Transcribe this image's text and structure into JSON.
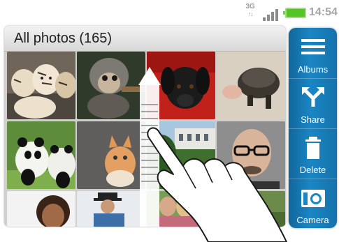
{
  "status_bar": {
    "network": "3G",
    "data_arrows": "↑↓",
    "time": "14:54",
    "battery_color": "#55c525"
  },
  "gallery": {
    "title": "All photos (165)",
    "photos": [
      {
        "subject": "tiger cubs"
      },
      {
        "subject": "baby monkey"
      },
      {
        "subject": "black puppy"
      },
      {
        "subject": "turtle"
      },
      {
        "subject": "pandas"
      },
      {
        "subject": "kitten"
      },
      {
        "subject": "building"
      },
      {
        "subject": "man with glasses"
      },
      {
        "subject": "woman"
      },
      {
        "subject": "man with hat"
      },
      {
        "subject": "women"
      },
      {
        "subject": "outdoor"
      }
    ]
  },
  "actions": [
    {
      "label": "Albums",
      "icon": "albums-icon"
    },
    {
      "label": "Share",
      "icon": "share-icon"
    },
    {
      "label": "Delete",
      "icon": "trash-icon"
    },
    {
      "label": "Camera",
      "icon": "camera-icon"
    }
  ],
  "colors": {
    "action_bar": "#1a86c4",
    "header_bg": "#e6e6e6"
  }
}
